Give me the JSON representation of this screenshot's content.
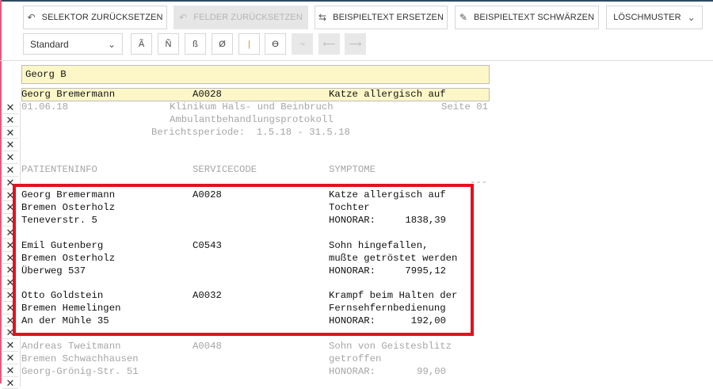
{
  "toolbar": {
    "reset_selector": "SELEKTOR ZURÜCKSETZEN",
    "reset_fields": "FELDER ZURÜCKSETZEN",
    "replace_sample": "BEISPIELTEXT ERSETZEN",
    "redact_sample": "BEISPIELTEXT SCHWÄRZEN",
    "delete_pattern": "LÖSCHMUSTER",
    "font_select": "Standard",
    "chars": [
      "Ã",
      "Ñ",
      "ß",
      "Ø",
      "|",
      "ϴ",
      "¬",
      "⟵",
      "⟶"
    ]
  },
  "search": {
    "value": "Georg B"
  },
  "hit_row": {
    "name": "Georg Bremermann",
    "code": "A0028",
    "symptom": "Katze allergisch auf"
  },
  "report": {
    "date": "01.06.18",
    "title": "Klinikum Hals- und Beinbruch",
    "page": "Seite 01",
    "subtitle": "Ambulantbehandlungsprotokoll",
    "period": "Berichtsperiode:  1.5.18 - 31.5.18",
    "headers": [
      "PATIENTENINFO",
      "SERVICECODE",
      "SYMPTOME"
    ],
    "dashes": "---",
    "records": [
      {
        "lines": [
          "Georg Bremermann",
          "Bremen Osterholz",
          "Teneverstr. 5"
        ],
        "code": "A0028",
        "sym": [
          "Katze allergisch auf",
          "Tochter"
        ],
        "honorar_label": "HONORAR:",
        "honorar": "1838,39"
      },
      {
        "lines": [
          "Emil Gutenberg",
          "Bremen Osterholz",
          "Überweg 537"
        ],
        "code": "C0543",
        "sym": [
          "Sohn hingefallen,",
          "mußte getröstet werden"
        ],
        "honorar_label": "HONORAR:",
        "honorar": "7995,12"
      },
      {
        "lines": [
          "Otto Goldstein",
          "Bremen Hemelingen",
          "An der Mühle 35"
        ],
        "code": "A0032",
        "sym": [
          "Krampf beim Halten der",
          "Fernsehfernbedienung"
        ],
        "honorar_label": "HONORAR:",
        "honorar": "192,00"
      },
      {
        "lines": [
          "Andreas Tweitmann",
          "Bremen Schwachhausen",
          "Georg-Grönig-Str. 51"
        ],
        "code": "A0048",
        "sym": [
          "Sohn von Geistesblitz",
          "getroffen"
        ],
        "honorar_label": "HONORAR:",
        "honorar": "99,00"
      }
    ]
  },
  "colors": {
    "highlight": "#fdf7c8",
    "box": "#e3121d"
  }
}
